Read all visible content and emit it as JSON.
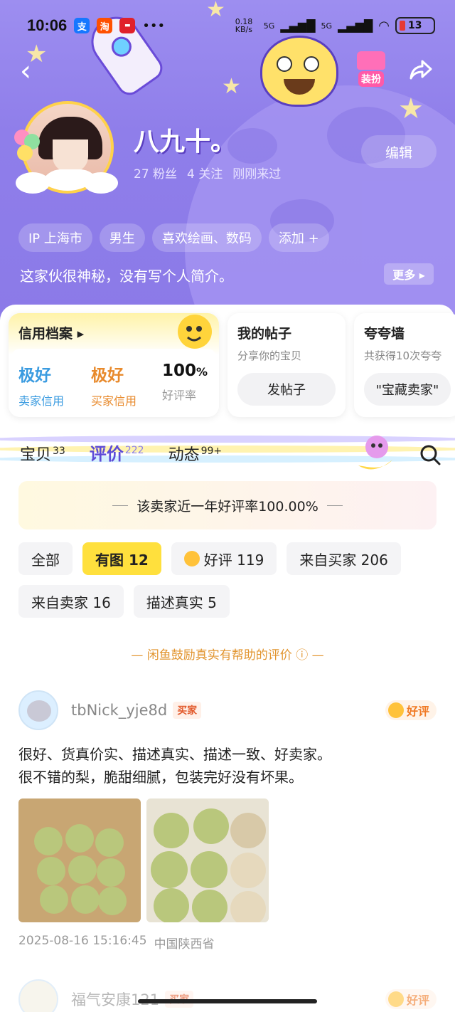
{
  "status_bar": {
    "time": "10:06",
    "apps": [
      {
        "icon": "alipay-icon",
        "glyph": "支",
        "color": "#1677ff"
      },
      {
        "icon": "taobao-icon",
        "glyph": "淘",
        "color": "#ff5000"
      },
      {
        "icon": "app-red-icon",
        "glyph": "▬",
        "color": "#e0202a"
      }
    ],
    "more": "•••",
    "net_speed": "0.18 KB/s",
    "signal_1": "5G",
    "signal_2": "5G",
    "battery": "13"
  },
  "header": {
    "back_icon": "‹",
    "dress_up_label": "装扮",
    "share_icon": "share-icon"
  },
  "profile": {
    "username": "八九十。",
    "fans": "27 粉丝",
    "following": "4 关注",
    "last_seen": "刚刚来过",
    "edit_label": "编辑",
    "tags": [
      "IP 上海市",
      "男生",
      "喜欢绘画、数码",
      "添加 +"
    ],
    "bio": "这家伙很神秘，没有写个人简介。",
    "more_label": "更多 ▸"
  },
  "credit_card": {
    "title": "信用档案 ▸",
    "seller_value": "极好",
    "seller_label": "卖家信用",
    "buyer_value": "极好",
    "buyer_label": "买家信用",
    "rate_value": "100",
    "rate_unit": "%",
    "rate_label": "好评率",
    "colors": {
      "seller": "#3a9be0",
      "buyer": "#e88a2c"
    }
  },
  "posts_card": {
    "title": "我的帖子",
    "subtitle": "分享你的宝贝",
    "button": "发帖子"
  },
  "wall_card": {
    "title": "夸夸墙",
    "subtitle": "共获得10次夸夸",
    "button": "\"宝藏卖家\""
  },
  "tabs": [
    {
      "label": "宝贝",
      "count": "33",
      "active": false
    },
    {
      "label": "评价",
      "count": "222",
      "active": true
    },
    {
      "label": "动态",
      "count": "99+",
      "active": false
    }
  ],
  "rate_banner": "该卖家近一年好评率100.00%",
  "filters": [
    {
      "label": "全部",
      "active": false
    },
    {
      "label": "有图 12",
      "active": true
    },
    {
      "label": "好评 119",
      "active": false,
      "icon": "smile-icon"
    },
    {
      "label": "来自买家 206",
      "active": false
    },
    {
      "label": "来自卖家 16",
      "active": false
    },
    {
      "label": "描述真实 5",
      "active": false
    }
  ],
  "encourage_text": "— 闲鱼鼓励真实有帮助的评价 ⓘ —",
  "review": {
    "user": "tbNick_yje8d",
    "role": "买家",
    "badge": "好评",
    "text_line1": "很好、货真价实、描述真实、描述一致、好卖家。",
    "text_line2": "很不错的梨，脆甜细腻，包装完好没有坏果。",
    "date": "2025-08-16 15:16:45",
    "location": "中国陕西省"
  },
  "next_review": {
    "user": "福气安康121",
    "role": "买家",
    "badge": "好评"
  }
}
